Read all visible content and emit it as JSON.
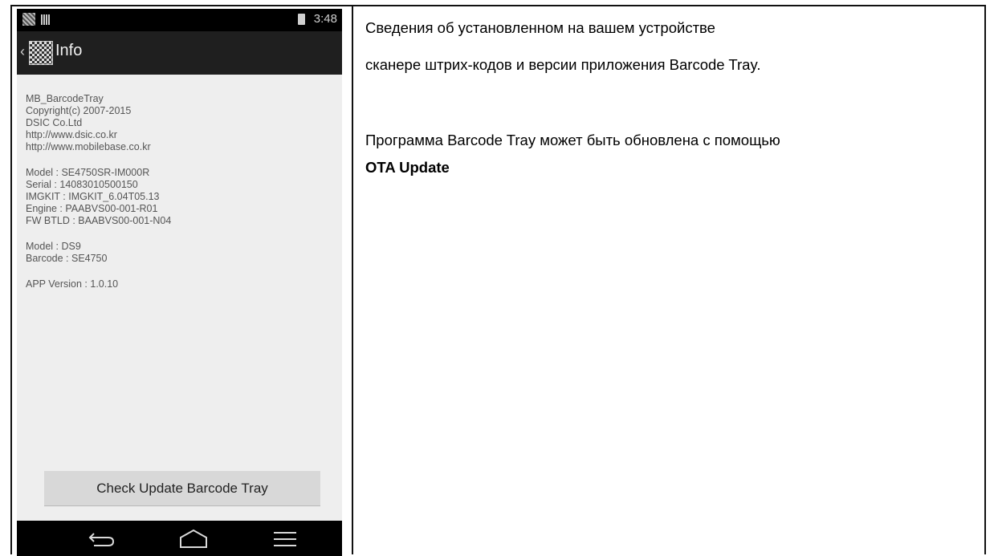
{
  "phone": {
    "status_time": "3:48",
    "title": "Info",
    "info_groups": [
      [
        "MB_BarcodeTray",
        "Copyright(c) 2007-2015",
        "DSIC Co.Ltd",
        "http://www.dsic.co.kr",
        "http://www.mobilebase.co.kr"
      ],
      [
        "Model : SE4750SR-IM000R",
        "Serial : 14083010500150",
        "IMGKIT : IMGKIT_6.04T05.13",
        "Engine : PAABVS00-001-R01",
        "FW BTLD : BAABVS00-001-N04"
      ],
      [
        "Model : DS9",
        "Barcode : SE4750"
      ],
      [
        "APP Version : 1.0.10"
      ]
    ],
    "update_button": "Check Update Barcode Tray",
    "icons": {
      "back": "back-arrow-icon",
      "app": "qr-code-icon",
      "battery": "battery-icon",
      "nav_back": "nav-back-icon",
      "nav_home": "nav-home-icon",
      "nav_recent": "nav-recent-icon"
    }
  },
  "description": {
    "line1": "Сведения об установленном на вашем устройстве",
    "line2": "сканере штрих-кодов и версии приложения Barcode Tray.",
    "line3": "Программа Barcode Tray может быть обновлена с помощью",
    "line4": "OTA Update"
  }
}
